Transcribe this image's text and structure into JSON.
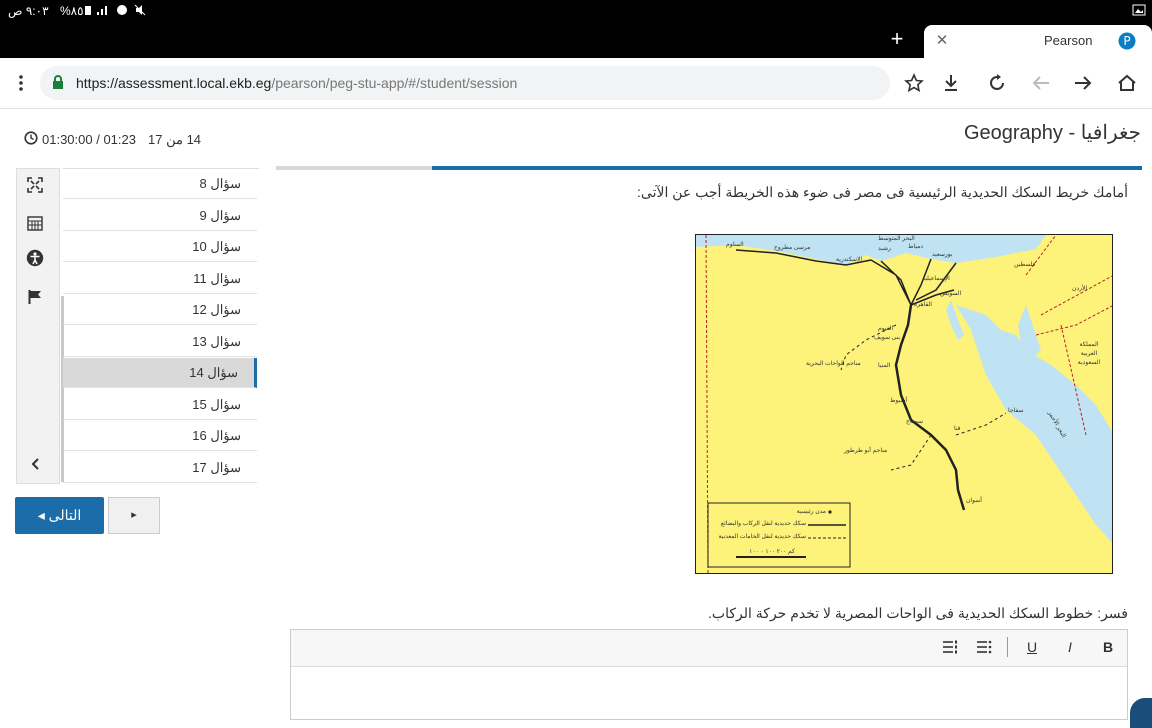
{
  "status_bar": {
    "time": "٩:٠٣ ص",
    "battery": "%٨٥"
  },
  "browser": {
    "tab_title": "Pearson",
    "url_host": "https://assessment.local.ekb.eg",
    "url_path": "/pearson/peg-stu-app/#/student/session"
  },
  "header": {
    "title": "Geography - جغرافيا",
    "progress": "14 من 17",
    "timer": "01:30:00 / 01:23",
    "progress_fraction": 0.82
  },
  "questions": [
    {
      "label": "سؤال 8"
    },
    {
      "label": "سؤال 9"
    },
    {
      "label": "سؤال 10"
    },
    {
      "label": "سؤال 11"
    },
    {
      "label": "سؤال 12"
    },
    {
      "label": "سؤال 13"
    },
    {
      "label": "سؤال 14"
    },
    {
      "label": "سؤال 15"
    },
    {
      "label": "سؤال 16"
    },
    {
      "label": "سؤال 17"
    }
  ],
  "nav": {
    "next_label": "التالى ◂",
    "play_label": "▸"
  },
  "question": {
    "prompt": "أمامك خريط السكك الحديدية الرئيسية فى مصر فى ضوء هذه الخريطة أجب عن الآتى:",
    "sub_prompt": "فسر: خطوط السكك الحديدية فى الواحات المصرية لا تخدم حركة الركاب."
  },
  "map": {
    "labels": {
      "sea": "البحر المتوسط",
      "salloum": "السلوم",
      "matrouh": "مرسى مطروح",
      "alex": "الإسكندرية",
      "rashid": "رشيد",
      "damietta": "دمياط",
      "portsaid": "بورسعيد",
      "ismailia": "الإسماعيلية",
      "suez": "السويس",
      "cairo": "القاهرة",
      "fayoum": "الفيوم",
      "benisuef": "بنى سويف",
      "minya": "المنيا",
      "bahariya": "مناجم الواحات البحرية",
      "asyut": "أسيوط",
      "sohag": "سوهاج",
      "qena": "قنا",
      "safaga": "سفاجا",
      "abutartur": "مناجم أبو طرطور",
      "aswan": "أسوان",
      "palestine": "فلسطين",
      "jordan": "الأردن",
      "saudi": "المملكة العربية السعودية",
      "redsea": "البحر الأحمر"
    },
    "legend": {
      "cities": "مدن رئيسية",
      "passenger": "سكك حديدية لنقل الركاب والبضائع",
      "mining": "سكك حديدية لنقل الخامات المعدنية",
      "scale": "كم ٢٠٠ ١٠٠ ٠ ١٠٠"
    },
    "colors": {
      "land": "#fdf27a",
      "sea": "#bfe3f2",
      "rail": "#222222"
    }
  },
  "editor": {
    "bold": "B",
    "italic": "I",
    "underline": "U"
  }
}
